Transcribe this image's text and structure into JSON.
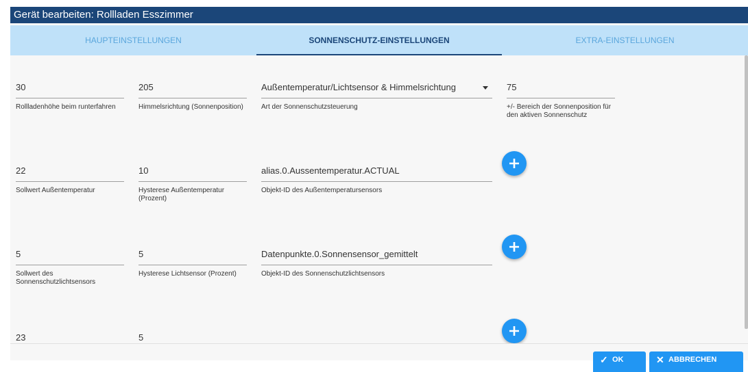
{
  "dialog": {
    "title": "Gerät bearbeiten: Rollladen Esszimmer"
  },
  "tabs": [
    {
      "label": "HAUPTEINSTELLUNGEN"
    },
    {
      "label": "SONNENSCHUTZ-EINSTELLUNGEN",
      "active": true
    },
    {
      "label": "EXTRA-EINSTELLUNGEN"
    }
  ],
  "rows": [
    {
      "f1": {
        "value": "30",
        "label": "Rollladenhöhe beim runterfahren"
      },
      "f2": {
        "value": "205",
        "label": "Himmelsrichtung (Sonnenposition)"
      },
      "f3": {
        "value": "Außentemperatur/Lichtsensor & Himmelsrichtung",
        "label": "Art der Sonnenschutzsteuerung"
      },
      "f4": {
        "value": "75",
        "label": "+/- Bereich der Sonnenposition für den aktiven Sonnenschutz"
      }
    },
    {
      "f1": {
        "value": "22",
        "label": "Sollwert Außentemperatur"
      },
      "f2": {
        "value": "10",
        "label": "Hysterese Außentemperatur (Prozent)"
      },
      "f3": {
        "value": "alias.0.Aussentemperatur.ACTUAL",
        "label": "Objekt-ID des Außentemperatursensors"
      }
    },
    {
      "f1": {
        "value": "5",
        "label": "Sollwert des Sonnenschutzlichtsensors"
      },
      "f2": {
        "value": "5",
        "label": "Hysterese Lichtsensor (Prozent)"
      },
      "f3": {
        "value": "Datenpunkte.0.Sonnensensor_gemittelt",
        "label": "Objekt-ID des Sonnenschutzlichtsensors"
      }
    },
    {
      "f1": {
        "value": "23"
      },
      "f2": {
        "value": "5"
      }
    }
  ],
  "footer": {
    "ok_label": "OK",
    "cancel_label": "ABBRECHEN"
  },
  "icons": {
    "add": "plus-icon",
    "ok": "check-icon",
    "cancel": "close-icon"
  },
  "colors": {
    "titlebar": "#1b4679",
    "tabs_bg": "#bfe1f9",
    "accent": "#2196f3"
  }
}
